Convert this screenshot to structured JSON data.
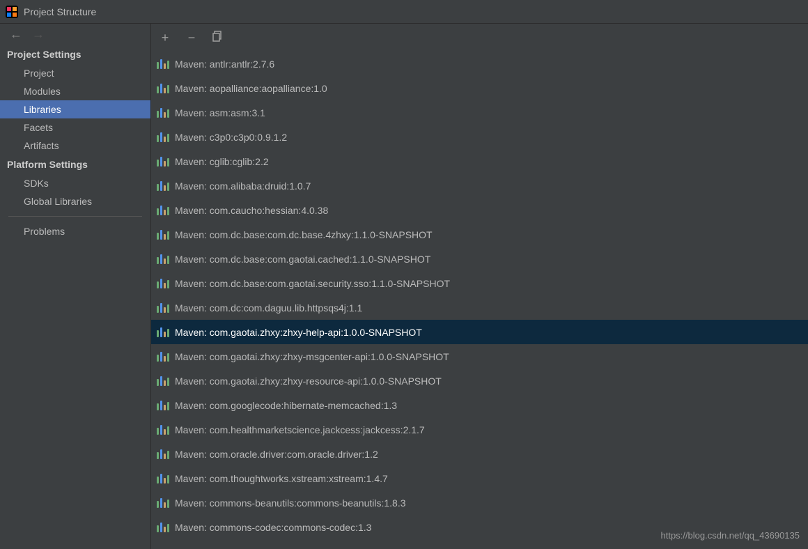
{
  "title": "Project Structure",
  "sidebar": {
    "sections": [
      {
        "header": "Project Settings",
        "items": [
          {
            "label": "Project",
            "selected": false
          },
          {
            "label": "Modules",
            "selected": false
          },
          {
            "label": "Libraries",
            "selected": true
          },
          {
            "label": "Facets",
            "selected": false
          },
          {
            "label": "Artifacts",
            "selected": false
          }
        ]
      },
      {
        "header": "Platform Settings",
        "items": [
          {
            "label": "SDKs",
            "selected": false
          },
          {
            "label": "Global Libraries",
            "selected": false
          }
        ]
      }
    ],
    "extra": {
      "label": "Problems"
    }
  },
  "libraries": [
    {
      "label": "Maven: antlr:antlr:2.7.6",
      "selected": false
    },
    {
      "label": "Maven: aopalliance:aopalliance:1.0",
      "selected": false
    },
    {
      "label": "Maven: asm:asm:3.1",
      "selected": false
    },
    {
      "label": "Maven: c3p0:c3p0:0.9.1.2",
      "selected": false
    },
    {
      "label": "Maven: cglib:cglib:2.2",
      "selected": false
    },
    {
      "label": "Maven: com.alibaba:druid:1.0.7",
      "selected": false
    },
    {
      "label": "Maven: com.caucho:hessian:4.0.38",
      "selected": false
    },
    {
      "label": "Maven: com.dc.base:com.dc.base.4zhxy:1.1.0-SNAPSHOT",
      "selected": false
    },
    {
      "label": "Maven: com.dc.base:com.gaotai.cached:1.1.0-SNAPSHOT",
      "selected": false
    },
    {
      "label": "Maven: com.dc.base:com.gaotai.security.sso:1.1.0-SNAPSHOT",
      "selected": false
    },
    {
      "label": "Maven: com.dc:com.daguu.lib.httpsqs4j:1.1",
      "selected": false
    },
    {
      "label": "Maven: com.gaotai.zhxy:zhxy-help-api:1.0.0-SNAPSHOT",
      "selected": true
    },
    {
      "label": "Maven: com.gaotai.zhxy:zhxy-msgcenter-api:1.0.0-SNAPSHOT",
      "selected": false
    },
    {
      "label": "Maven: com.gaotai.zhxy:zhxy-resource-api:1.0.0-SNAPSHOT",
      "selected": false
    },
    {
      "label": "Maven: com.googlecode:hibernate-memcached:1.3",
      "selected": false
    },
    {
      "label": "Maven: com.healthmarketscience.jackcess:jackcess:2.1.7",
      "selected": false
    },
    {
      "label": "Maven: com.oracle.driver:com.oracle.driver:1.2",
      "selected": false
    },
    {
      "label": "Maven: com.thoughtworks.xstream:xstream:1.4.7",
      "selected": false
    },
    {
      "label": "Maven: commons-beanutils:commons-beanutils:1.8.3",
      "selected": false
    },
    {
      "label": "Maven: commons-codec:commons-codec:1.3",
      "selected": false
    }
  ],
  "watermark": "https://blog.csdn.net/qq_43690135"
}
